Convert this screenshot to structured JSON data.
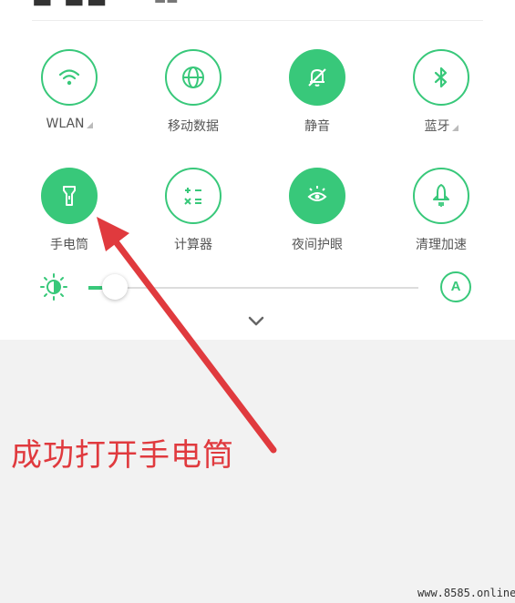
{
  "quick_settings": {
    "tiles": [
      {
        "label": "WLAN",
        "icon": "wifi-icon",
        "active": false,
        "has_more": true
      },
      {
        "label": "移动数据",
        "icon": "globe-icon",
        "active": false,
        "has_more": false
      },
      {
        "label": "静音",
        "icon": "bell-mute-icon",
        "active": true,
        "has_more": false
      },
      {
        "label": "蓝牙",
        "icon": "bluetooth-icon",
        "active": false,
        "has_more": true
      },
      {
        "label": "手电筒",
        "icon": "flashlight-icon",
        "active": true,
        "has_more": false
      },
      {
        "label": "计算器",
        "icon": "calculator-icon",
        "active": false,
        "has_more": false
      },
      {
        "label": "夜间护眼",
        "icon": "eye-care-icon",
        "active": true,
        "has_more": false
      },
      {
        "label": "清理加速",
        "icon": "rocket-icon",
        "active": false,
        "has_more": false
      }
    ],
    "brightness": {
      "level": 0.08,
      "auto_label": "A"
    },
    "accent_color": "#38c87a"
  },
  "annotation": {
    "text": "成功打开手电筒",
    "color": "#e03a3e"
  },
  "watermark": "www.8585.online"
}
